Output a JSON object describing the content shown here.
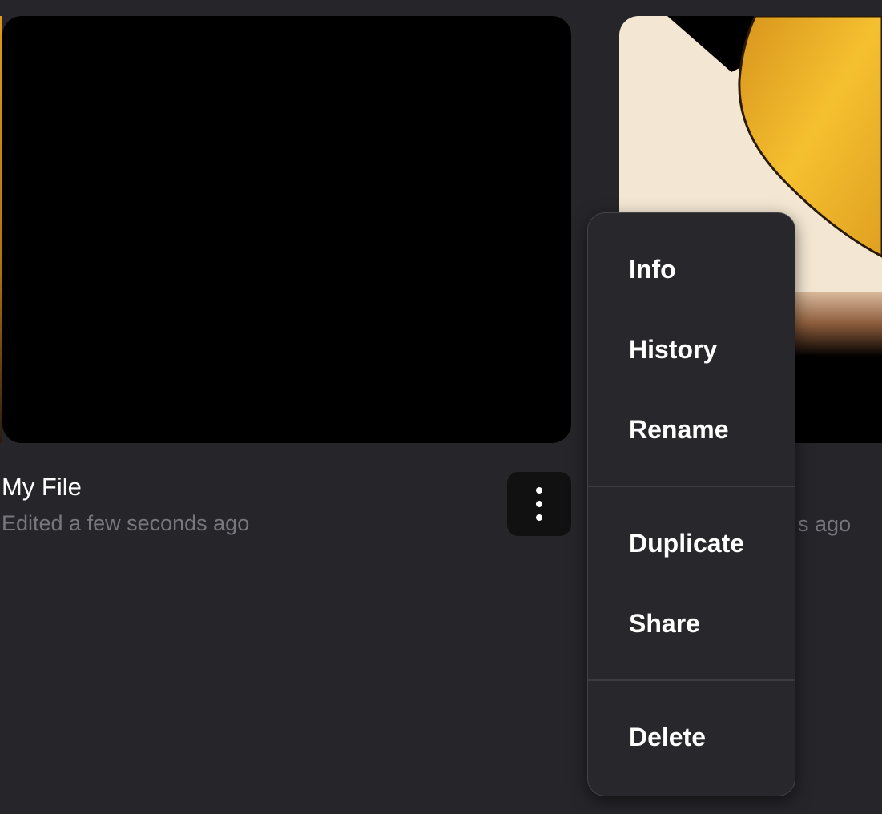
{
  "files": [
    {
      "title": "My File",
      "subtitle": "Edited a few seconds ago",
      "thumbnail_color": "#000000"
    },
    {
      "subtitle_visible": "s ago"
    }
  ],
  "context_menu": {
    "groups": [
      [
        "Info",
        "History",
        "Rename"
      ],
      [
        "Duplicate",
        "Share"
      ],
      [
        "Delete"
      ]
    ]
  },
  "colors": {
    "background": "#25252a",
    "menu": "#27272c",
    "muted_text": "#77777d"
  }
}
